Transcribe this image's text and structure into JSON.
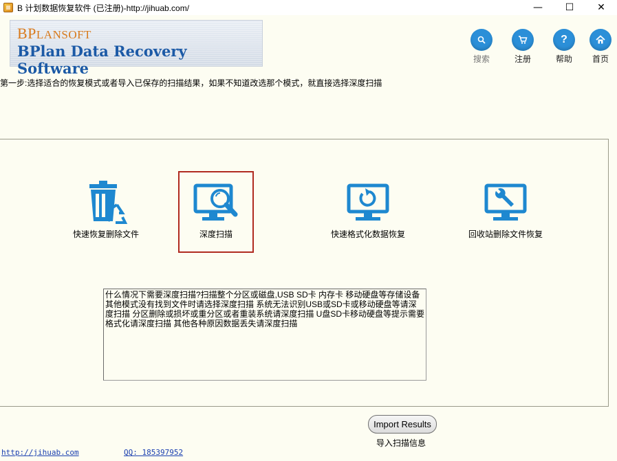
{
  "window": {
    "title": "B 计划数据恢复软件 (已注册)-http://jihuab.com/",
    "minimize": "—",
    "maximize": "☐",
    "close": "✕"
  },
  "header": {
    "brand_first": "BP",
    "brand_rest": "LANSOFT",
    "product": "BPlan Data Recovery Software",
    "nav": [
      {
        "label": "搜索",
        "icon": "search-icon"
      },
      {
        "label": "注册",
        "icon": "cart-icon"
      },
      {
        "label": "帮助",
        "icon": "help-icon"
      },
      {
        "label": "首页",
        "icon": "home-icon"
      }
    ]
  },
  "step_text": "第一步:选择适合的恢复模式或者导入已保存的扫描结果，如果不知道改选那个模式，就直接选择深度扫描",
  "modes": [
    {
      "label": "快速恢复删除文件",
      "icon": "recycle-bin-icon"
    },
    {
      "label": "深度扫描",
      "icon": "monitor-search-icon"
    },
    {
      "label": "快速格式化数据恢复",
      "icon": "monitor-refresh-icon"
    },
    {
      "label": "回收站删除文件恢复",
      "icon": "monitor-wrench-icon"
    }
  ],
  "description": "什么情况下需要深度扫描?扫描整个分区或磁盘,USB SD卡 内存卡 移动硬盘等存储设备 其他模式没有找到文件时请选择深度扫描 系统无法识别USB或SD卡或移动硬盘等请深度扫描 分区删除或损坏或重分区或者重装系统请深度扫描 U盘SD卡移动硬盘等提示需要格式化请深度扫描 其他各种原因数据丢失请深度扫描",
  "import": {
    "button": "Import Results",
    "label": "导入扫描信息"
  },
  "footer": {
    "site": "http://jihuab.com",
    "qq": "QQ: 185397952"
  },
  "colors": {
    "nav_blue": "#2b8fd8",
    "icon_blue": "#1e88d0",
    "selected_border": "#b02a20",
    "brand_orange": "#d87a1c",
    "product_blue": "#1c5aa6"
  }
}
